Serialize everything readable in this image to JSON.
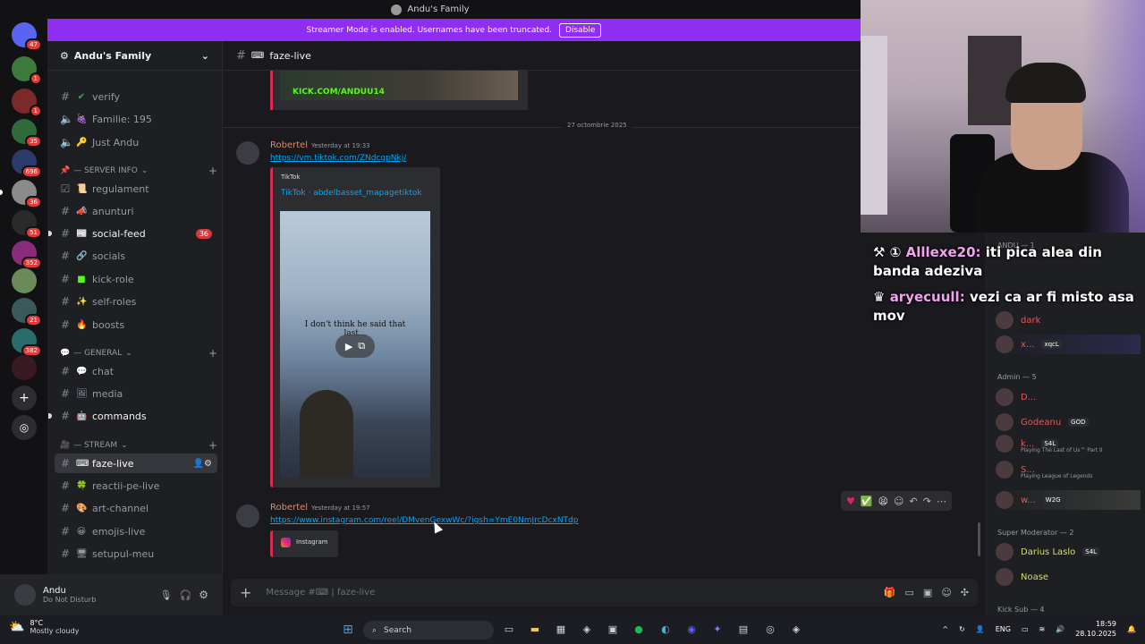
{
  "window": {
    "title": "Andu's Family"
  },
  "banner": {
    "text": "Streamer Mode is enabled. Usernames have been truncated.",
    "button": "Disable"
  },
  "guild_badges": [
    "47",
    "1",
    "1",
    "35",
    "696",
    "36",
    "51",
    "352",
    "21",
    "382"
  ],
  "server": {
    "name": "Andu's Family"
  },
  "channels": {
    "verify": "verify",
    "familie": "Familie: 195",
    "just_andu": "Just Andu",
    "cat_server_info": "— SERVER INFO",
    "regulament": "regulament",
    "anunturi": "anunturi",
    "social_feed": "social-feed",
    "social_feed_count": "36",
    "socials": "socials",
    "kick_role": "kick-role",
    "self_roles": "self-roles",
    "boosts": "boosts",
    "cat_general": "— GENERAL",
    "chat": "chat",
    "media": "media",
    "commands": "commands",
    "cat_stream": "— STREAM",
    "faze_live": "faze-live",
    "reactii": "reactii-pe-live",
    "art": "art-channel",
    "emojis": "emojis-live",
    "setupul": "setupul-meu"
  },
  "user_panel": {
    "name": "Andu",
    "status": "Do Not Disturb"
  },
  "channel_header": {
    "name": "faze-live"
  },
  "messages": {
    "old_embed_text": "KICK.COM/ANDUU14",
    "date_divider": "27 octombrie 2025",
    "m1_author": "Robertel",
    "m1_time": "Yesterday at 19:33",
    "m1_link": "https://vm.tiktok.com/ZNdcgpNkj/",
    "m1_provider": "TikTok",
    "m1_embed_title": "TikTok · abdelbasset_mapagetiktok",
    "m1_video_caption": "I don't think he said that last...",
    "m2_author": "Robertel",
    "m2_time": "Yesterday at 19:57",
    "m2_link": "https://www.instagram.com/reel/DMvenGexwWc/?igsh=YmE0NmJrcDcxNTdp",
    "m2_embed": "Instagram"
  },
  "composer": {
    "placeholder": "Message #⌨ | faze-live"
  },
  "stream_chat": [
    {
      "user": "Alllexe20:",
      "text": "iti pica alea din banda adeziva"
    },
    {
      "user": "aryecuull:",
      "text": "vezi ca ar fi misto asa mov"
    }
  ],
  "members": {
    "top_label": "ANDU — 1",
    "dark": "dark",
    "x_name": "x...",
    "x_tag": "xqcL",
    "admin_head": "Admin — 5",
    "a1": "D...",
    "a2": "Godeanu",
    "a2_tag": "GOD",
    "a3": "k...",
    "a3_tag": "S4L",
    "a3_act": "Playing The Last of Us™ Part II",
    "a4": "S...",
    "a4_act": "Playing League of Legends",
    "a5": "w...",
    "a5_tag": "W2G",
    "supermod_head": "Super Moderator — 2",
    "s1": "Darius Laslo",
    "s1_tag": "S4L",
    "s2": "Noase",
    "kicksub_head": "Kick Sub — 4"
  },
  "taskbar": {
    "temp": "8°C",
    "weather": "Mostly cloudy",
    "search": "Search",
    "lang": "ENG",
    "time": "18:59",
    "date": "28.10.2025"
  }
}
